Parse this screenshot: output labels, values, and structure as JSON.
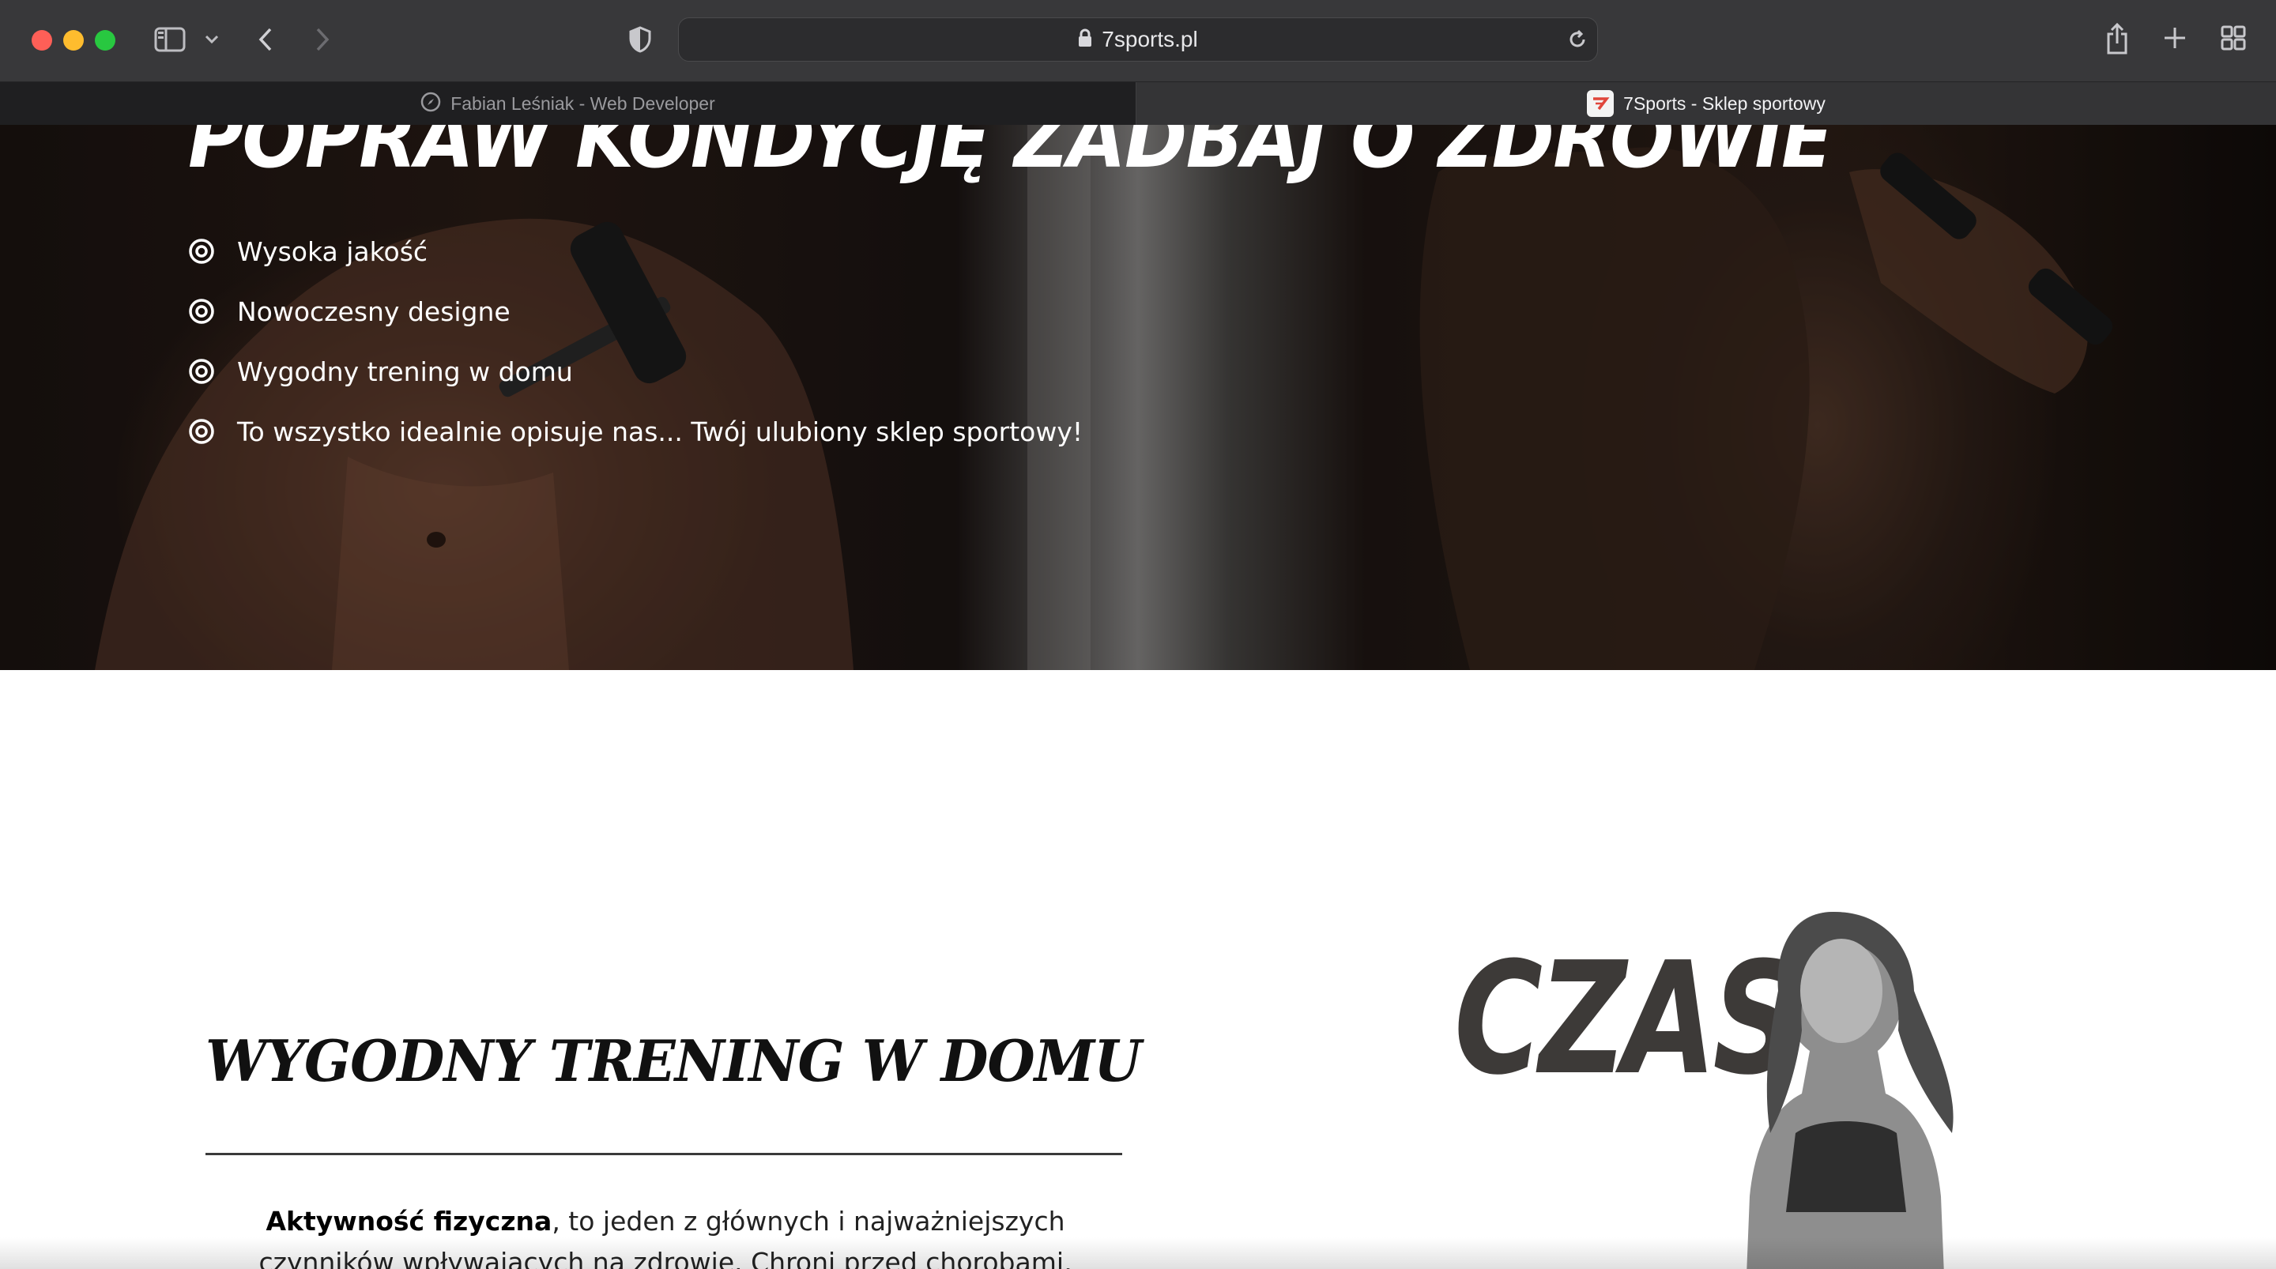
{
  "browser": {
    "address": "7sports.pl",
    "tabs": [
      {
        "label": "Fabian Leśniak - Web Developer",
        "active": false
      },
      {
        "label": "7Sports - Sklep sportowy",
        "active": true
      }
    ],
    "colors": {
      "close": "#fe5f57",
      "minimize": "#febc2e",
      "zoom": "#28c840"
    }
  },
  "hero": {
    "title": "POPRAW KONDYCJĘ  ZADBAJ O ZDROWIE",
    "features": [
      "Wysoka jakość",
      "Nowoczesny designe",
      "Wygodny trening w domu",
      "To wszystko idealnie opisuje nas... Twój ulubiony sklep sportowy!"
    ]
  },
  "section": {
    "title": "WYGODNY TRENING W DOMU",
    "paragraph_bold": "Aktywność fizyczna",
    "paragraph_rest": ", to jeden z głównych i najważniejszych czynników wpływających na zdrowie. Chroni przed chorobami, modeluje sylwetkę"
  },
  "promo": {
    "word": "CZAS"
  }
}
